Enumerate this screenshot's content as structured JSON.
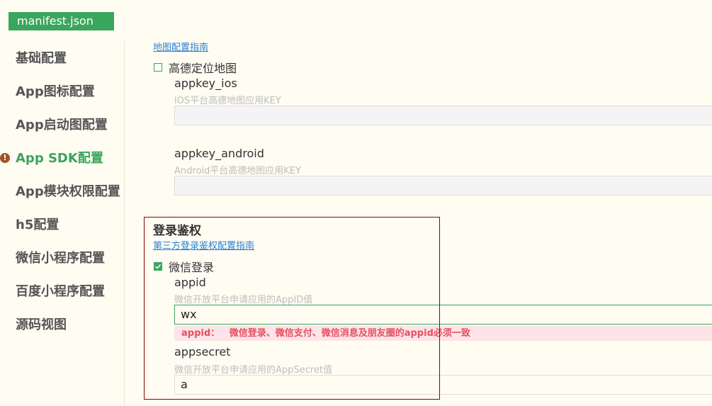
{
  "file_tab": {
    "label": "manifest.json"
  },
  "sidebar": {
    "items": [
      {
        "label": "基础配置"
      },
      {
        "label": "App图标配置"
      },
      {
        "label": "App启动图配置"
      },
      {
        "label": "App SDK配置",
        "active": true,
        "warning": true
      },
      {
        "label": "App模块权限配置"
      },
      {
        "label": "h5配置"
      },
      {
        "label": "微信小程序配置"
      },
      {
        "label": "百度小程序配置"
      },
      {
        "label": "源码视图"
      }
    ],
    "warning_icon": "exclamation-icon"
  },
  "map_section": {
    "guide_link": "地图配置指南",
    "gaode_checkbox": {
      "label": "高德定位地图",
      "checked": false
    },
    "appkey_ios": {
      "label": "appkey_ios",
      "hint": "iOS平台高德地图应用KEY",
      "value": ""
    },
    "appkey_android": {
      "label": "appkey_android",
      "hint": "Android平台高德地图应用KEY",
      "value": ""
    }
  },
  "login_section": {
    "title": "登录鉴权",
    "guide_link": "第三方登录鉴权配置指南",
    "wechat_checkbox": {
      "label": "微信登录",
      "checked": true
    },
    "appid": {
      "label": "appid",
      "hint": "微信开放平台申请应用的AppID值",
      "value": "wx"
    },
    "error_message": "appid：   微信登录、微信支付、微信消息及朋友圈的appid必须一致",
    "appsecret": {
      "label": "appsecret",
      "hint": "微信开放平台申请应用的AppSecret值",
      "value": "a"
    }
  },
  "colors": {
    "accent": "#3aa55d",
    "error": "#e35162",
    "highlight_border": "#8b0000",
    "background": "#fffcf2"
  }
}
